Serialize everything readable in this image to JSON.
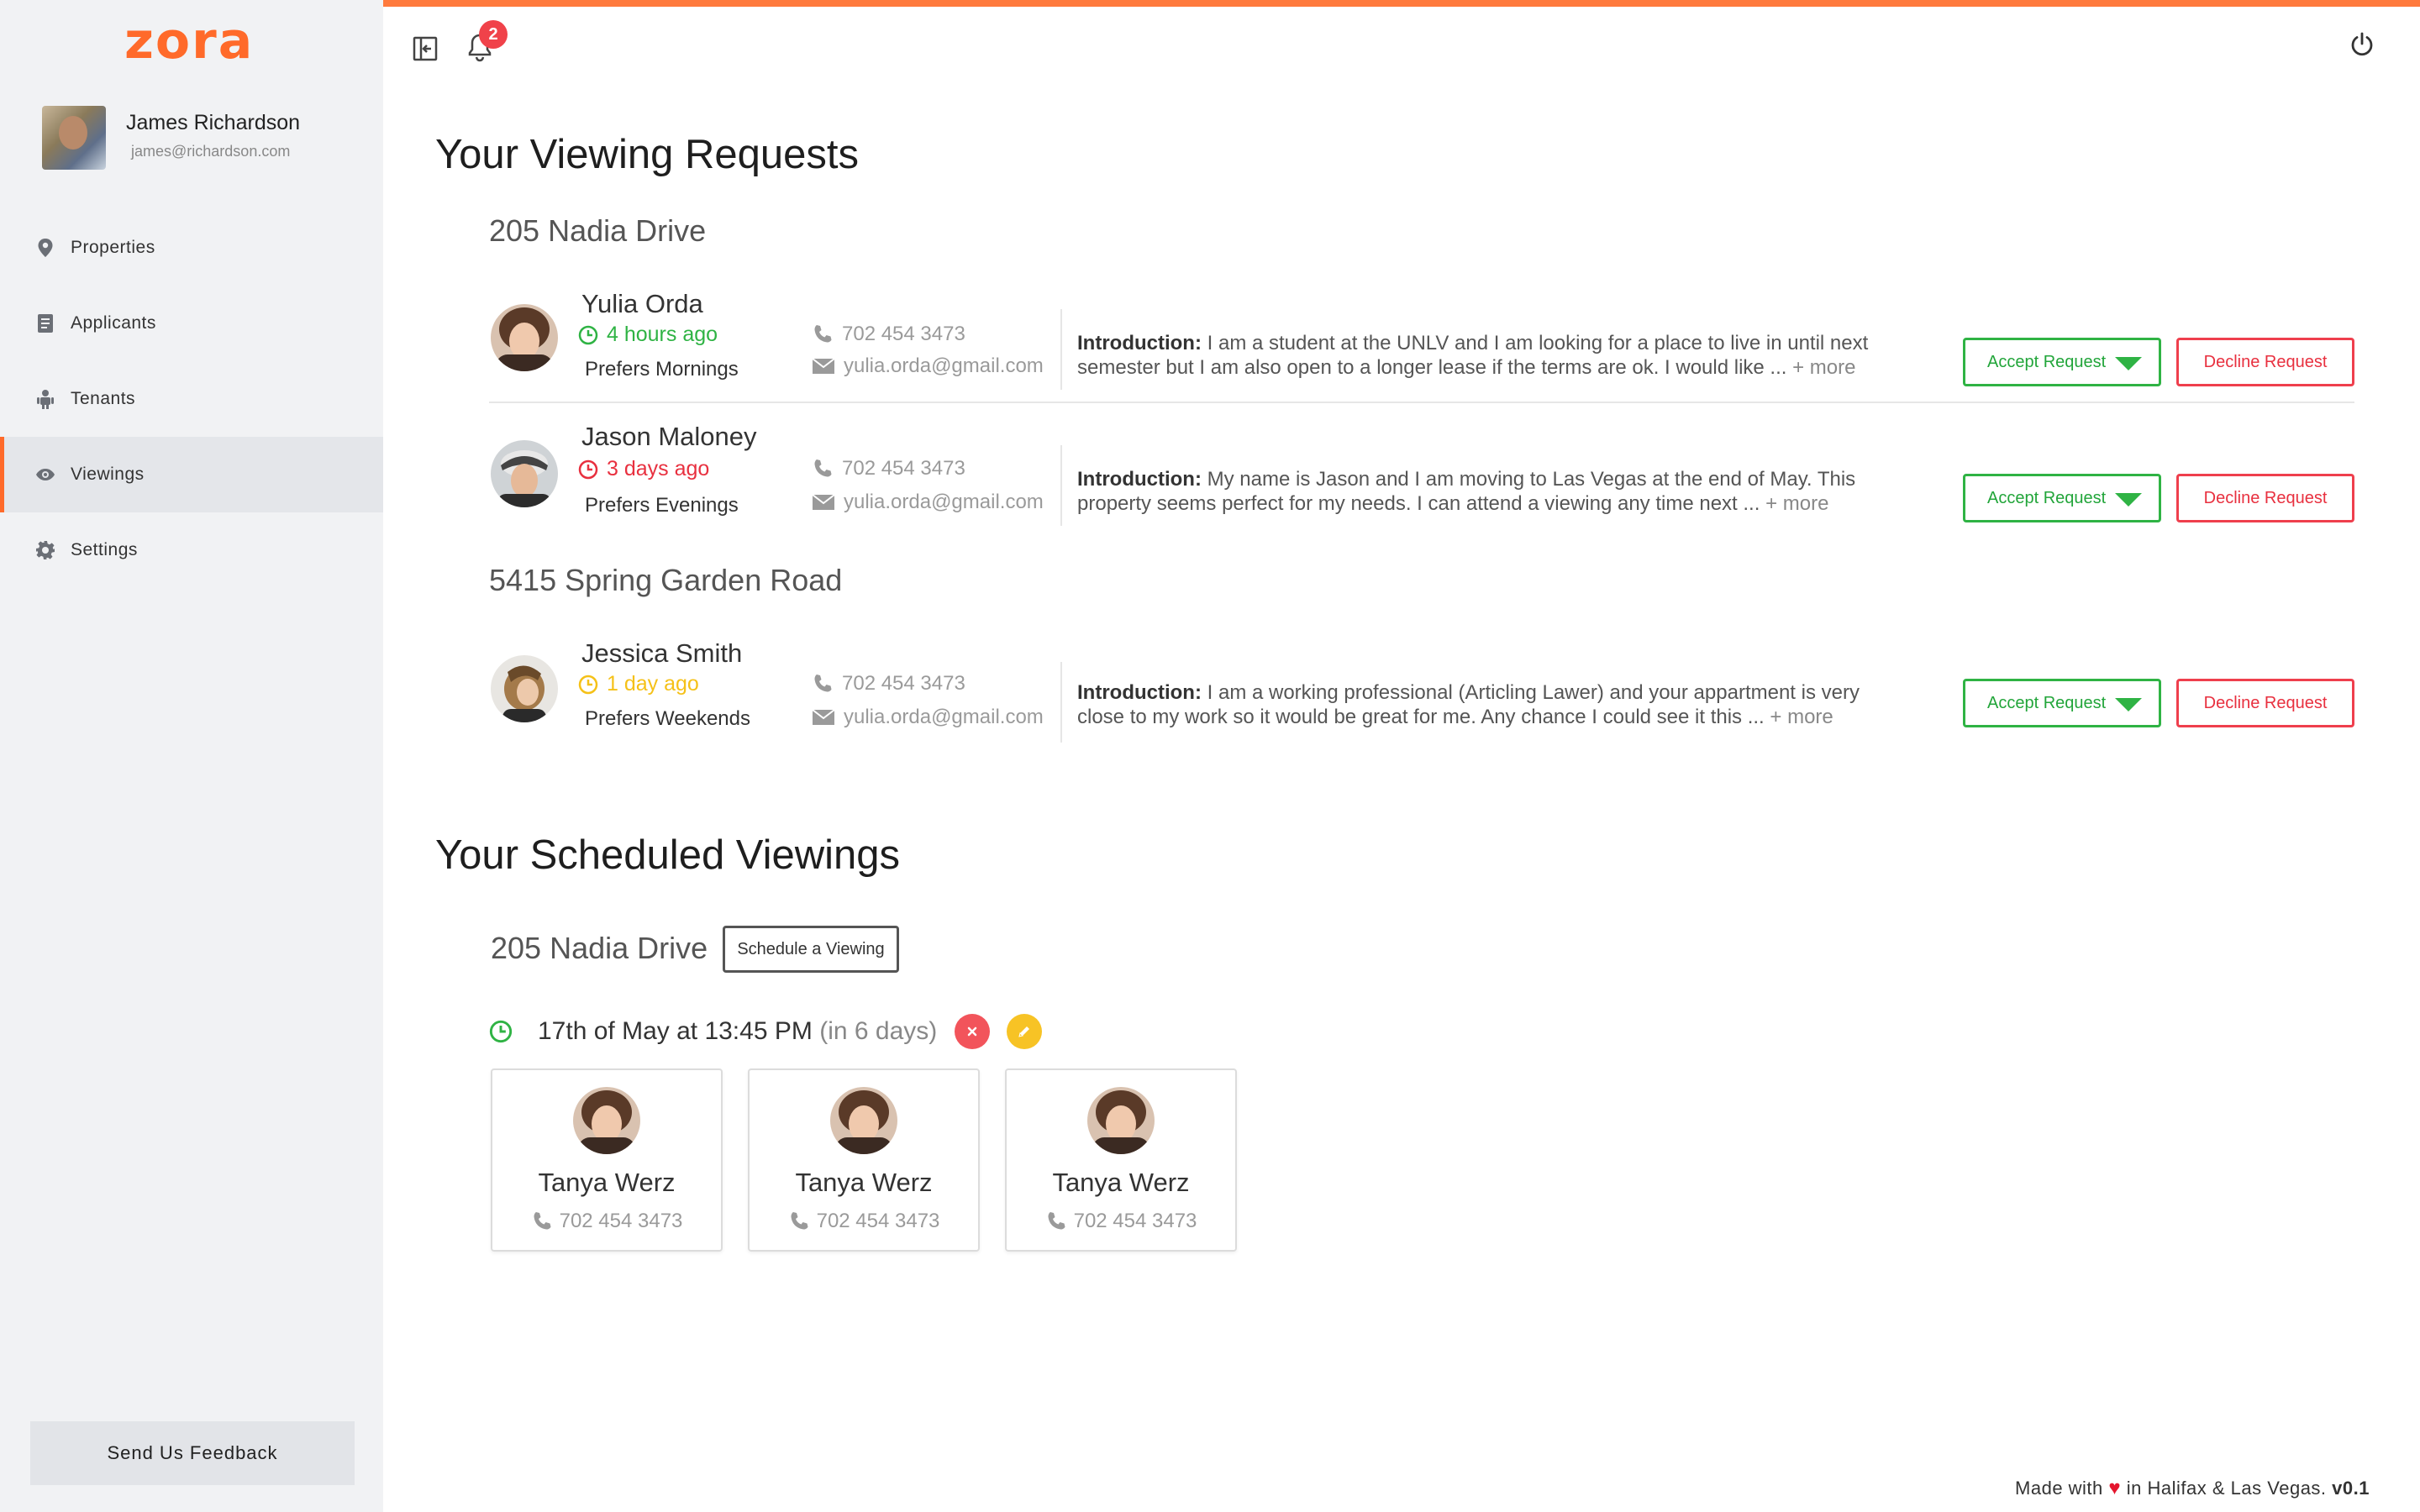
{
  "app": {
    "logo": "zora"
  },
  "user": {
    "name": "James Richardson",
    "email": "james@richardson.com"
  },
  "nav": {
    "items": [
      {
        "label": "Properties",
        "icon": "map-pin-icon"
      },
      {
        "label": "Applicants",
        "icon": "document-icon"
      },
      {
        "label": "Tenants",
        "icon": "person-icon"
      },
      {
        "label": "Viewings",
        "icon": "eye-icon"
      },
      {
        "label": "Settings",
        "icon": "gear-icon"
      }
    ],
    "active": "Viewings"
  },
  "feedback_label": "Send Us Feedback",
  "notifications": {
    "count": "2"
  },
  "colors": {
    "brand": "#ff6a2a",
    "accept": "#2fb344",
    "decline": "#ef3f4d",
    "pending_green": "#2fb344",
    "pending_red": "#e8303f",
    "pending_yellow": "#f5c118",
    "edit": "#f7c325"
  },
  "requests": {
    "title": "Your Viewing Requests",
    "accept_label": "Accept Request",
    "decline_label": "Decline Request",
    "intro_label": "Introduction:",
    "groups": [
      {
        "property": "205 Nadia Drive",
        "items": [
          {
            "name": "Yulia Orda",
            "time_ago": "4 hours ago",
            "time_color": "green",
            "preference": "Prefers Mornings",
            "phone": "702 454 3473",
            "email": "yulia.orda@gmail.com",
            "intro": "I am a student at the UNLV and I am looking for a place to live in until next semester but I am also open to a longer lease if the terms are ok. I would like ...",
            "more": "+ more"
          },
          {
            "name": "Jason Maloney",
            "time_ago": "3 days ago",
            "time_color": "red",
            "preference": "Prefers Evenings",
            "phone": "702 454 3473",
            "email": "yulia.orda@gmail.com",
            "intro": "My name is Jason and I am moving to Las Vegas at the end of May. This property seems perfect for my needs. I can attend a viewing any time next ...",
            "more": "+ more"
          }
        ]
      },
      {
        "property": "5415 Spring Garden Road",
        "items": [
          {
            "name": "Jessica Smith",
            "time_ago": "1 day ago",
            "time_color": "yellow",
            "preference": "Prefers Weekends",
            "phone": "702 454 3473",
            "email": "yulia.orda@gmail.com",
            "intro": "I am a working professional (Articling Lawer) and your appartment is very close to my work so it would be great for me. Any chance I could see it this ...",
            "more": "+ more"
          }
        ]
      }
    ]
  },
  "scheduled": {
    "title": "Your Scheduled Viewings",
    "property": "205 Nadia Drive",
    "schedule_button": "Schedule a Viewing",
    "datetime": "17th of May at 13:45 PM",
    "relative": "(in 6 days)",
    "attendees": [
      {
        "name": "Tanya Werz",
        "phone": "702 454 3473"
      },
      {
        "name": "Tanya Werz",
        "phone": "702 454 3473"
      },
      {
        "name": "Tanya Werz",
        "phone": "702 454 3473"
      }
    ]
  },
  "footer": {
    "prefix": "Made with",
    "heart": "♥",
    "suffix": "in Halifax & Las Vegas.",
    "version": "v0.1"
  }
}
